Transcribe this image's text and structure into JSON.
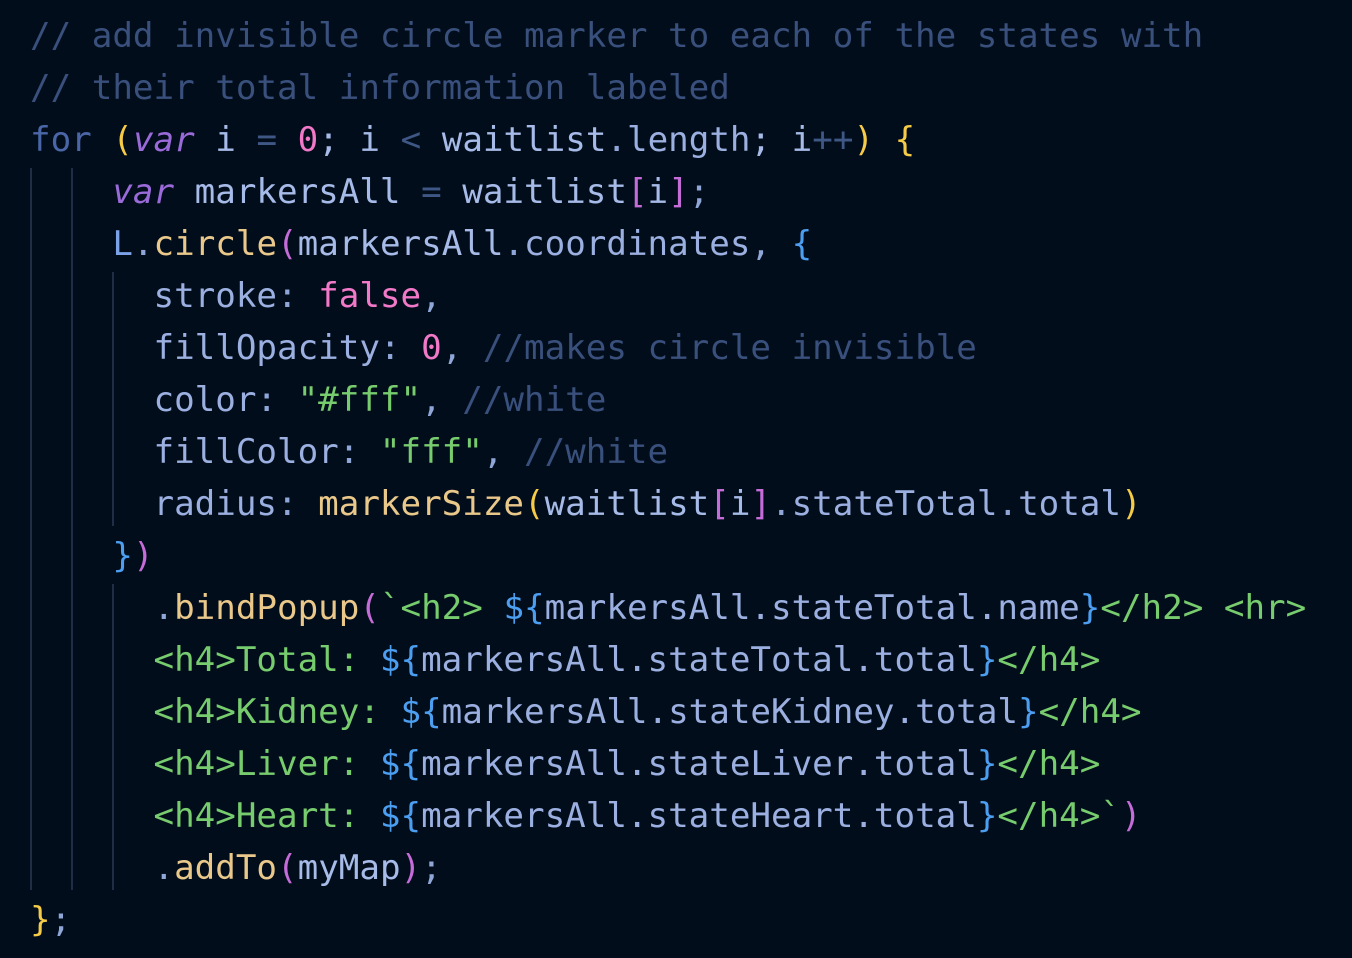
{
  "code": {
    "lines": [
      [
        {
          "t": "// add invisible circle marker to each of the states with",
          "c": "c-comment",
          "name": "comment-token"
        }
      ],
      [
        {
          "t": "// their total information labeled",
          "c": "c-comment",
          "name": "comment-token"
        }
      ],
      [
        {
          "t": "for",
          "c": "c-keyword",
          "name": "keyword-token"
        },
        {
          "t": " ",
          "c": "c-punct",
          "name": "space-token"
        },
        {
          "t": "(",
          "c": "c-paren1",
          "name": "paren-token"
        },
        {
          "t": "var",
          "c": "c-italic-kw",
          "name": "keyword-token"
        },
        {
          "t": " i ",
          "c": "c-var",
          "name": "identifier-token"
        },
        {
          "t": "=",
          "c": "c-op",
          "name": "operator-token"
        },
        {
          "t": " ",
          "c": "c-punct",
          "name": "space-token"
        },
        {
          "t": "0",
          "c": "c-num",
          "name": "number-token"
        },
        {
          "t": "; i ",
          "c": "c-var",
          "name": "identifier-token"
        },
        {
          "t": "<",
          "c": "c-op",
          "name": "operator-token"
        },
        {
          "t": " waitlist",
          "c": "c-var",
          "name": "identifier-token"
        },
        {
          "t": ".",
          "c": "c-punct",
          "name": "punct-token"
        },
        {
          "t": "length",
          "c": "c-prop",
          "name": "property-token"
        },
        {
          "t": "; i",
          "c": "c-var",
          "name": "identifier-token"
        },
        {
          "t": "++",
          "c": "c-op",
          "name": "operator-token"
        },
        {
          "t": ")",
          "c": "c-paren1",
          "name": "paren-token"
        },
        {
          "t": " ",
          "c": "c-punct",
          "name": "space-token"
        },
        {
          "t": "{",
          "c": "c-paren1",
          "name": "brace-token"
        }
      ],
      [
        {
          "t": "    ",
          "c": "c-punct",
          "name": "indent-token"
        },
        {
          "t": "var",
          "c": "c-italic-kw",
          "name": "keyword-token"
        },
        {
          "t": " markersAll ",
          "c": "c-var",
          "name": "identifier-token"
        },
        {
          "t": "=",
          "c": "c-op",
          "name": "operator-token"
        },
        {
          "t": " waitlist",
          "c": "c-var",
          "name": "identifier-token"
        },
        {
          "t": "[",
          "c": "c-paren2",
          "name": "bracket-token"
        },
        {
          "t": "i",
          "c": "c-var",
          "name": "identifier-token"
        },
        {
          "t": "]",
          "c": "c-paren2",
          "name": "bracket-token"
        },
        {
          "t": ";",
          "c": "c-punct",
          "name": "punct-token"
        }
      ],
      [
        {
          "t": "    ",
          "c": "c-punct",
          "name": "indent-token"
        },
        {
          "t": "L",
          "c": "c-obj",
          "name": "object-token"
        },
        {
          "t": ".",
          "c": "c-punct",
          "name": "punct-token"
        },
        {
          "t": "circle",
          "c": "c-func",
          "name": "function-token"
        },
        {
          "t": "(",
          "c": "c-paren2",
          "name": "paren-token"
        },
        {
          "t": "markersAll",
          "c": "c-var",
          "name": "identifier-token"
        },
        {
          "t": ".",
          "c": "c-punct",
          "name": "punct-token"
        },
        {
          "t": "coordinates",
          "c": "c-prop",
          "name": "property-token"
        },
        {
          "t": ", ",
          "c": "c-punct",
          "name": "punct-token"
        },
        {
          "t": "{",
          "c": "c-paren3",
          "name": "brace-token"
        }
      ],
      [
        {
          "t": "      ",
          "c": "c-punct",
          "name": "indent-token"
        },
        {
          "t": "stroke",
          "c": "c-prop",
          "name": "property-token"
        },
        {
          "t": ": ",
          "c": "c-punct",
          "name": "punct-token"
        },
        {
          "t": "false",
          "c": "c-num",
          "name": "boolean-token"
        },
        {
          "t": ",",
          "c": "c-punct",
          "name": "punct-token"
        }
      ],
      [
        {
          "t": "      ",
          "c": "c-punct",
          "name": "indent-token"
        },
        {
          "t": "fillOpacity",
          "c": "c-prop",
          "name": "property-token"
        },
        {
          "t": ": ",
          "c": "c-punct",
          "name": "punct-token"
        },
        {
          "t": "0",
          "c": "c-num",
          "name": "number-token"
        },
        {
          "t": ", ",
          "c": "c-punct",
          "name": "punct-token"
        },
        {
          "t": "//makes circle invisible",
          "c": "c-comment",
          "name": "comment-token"
        }
      ],
      [
        {
          "t": "      ",
          "c": "c-punct",
          "name": "indent-token"
        },
        {
          "t": "color",
          "c": "c-prop",
          "name": "property-token"
        },
        {
          "t": ": ",
          "c": "c-punct",
          "name": "punct-token"
        },
        {
          "t": "\"#fff\"",
          "c": "c-str",
          "name": "string-token"
        },
        {
          "t": ", ",
          "c": "c-punct",
          "name": "punct-token"
        },
        {
          "t": "//white",
          "c": "c-comment",
          "name": "comment-token"
        }
      ],
      [
        {
          "t": "      ",
          "c": "c-punct",
          "name": "indent-token"
        },
        {
          "t": "fillColor",
          "c": "c-prop",
          "name": "property-token"
        },
        {
          "t": ": ",
          "c": "c-punct",
          "name": "punct-token"
        },
        {
          "t": "\"fff\"",
          "c": "c-str",
          "name": "string-token"
        },
        {
          "t": ", ",
          "c": "c-punct",
          "name": "punct-token"
        },
        {
          "t": "//white",
          "c": "c-comment",
          "name": "comment-token"
        }
      ],
      [
        {
          "t": "      ",
          "c": "c-punct",
          "name": "indent-token"
        },
        {
          "t": "radius",
          "c": "c-prop",
          "name": "property-token"
        },
        {
          "t": ": ",
          "c": "c-punct",
          "name": "punct-token"
        },
        {
          "t": "markerSize",
          "c": "c-func",
          "name": "function-token"
        },
        {
          "t": "(",
          "c": "c-paren1",
          "name": "paren-token"
        },
        {
          "t": "waitlist",
          "c": "c-var",
          "name": "identifier-token"
        },
        {
          "t": "[",
          "c": "c-paren2",
          "name": "bracket-token"
        },
        {
          "t": "i",
          "c": "c-var",
          "name": "identifier-token"
        },
        {
          "t": "]",
          "c": "c-paren2",
          "name": "bracket-token"
        },
        {
          "t": ".",
          "c": "c-punct",
          "name": "punct-token"
        },
        {
          "t": "stateTotal",
          "c": "c-prop",
          "name": "property-token"
        },
        {
          "t": ".",
          "c": "c-punct",
          "name": "punct-token"
        },
        {
          "t": "total",
          "c": "c-prop",
          "name": "property-token"
        },
        {
          "t": ")",
          "c": "c-paren1",
          "name": "paren-token"
        }
      ],
      [
        {
          "t": "    ",
          "c": "c-punct",
          "name": "indent-token"
        },
        {
          "t": "}",
          "c": "c-paren3",
          "name": "brace-token"
        },
        {
          "t": ")",
          "c": "c-paren2",
          "name": "paren-token"
        }
      ],
      [
        {
          "t": "      ",
          "c": "c-punct",
          "name": "indent-token"
        },
        {
          "t": ".",
          "c": "c-punct",
          "name": "punct-token"
        },
        {
          "t": "bindPopup",
          "c": "c-func",
          "name": "function-token"
        },
        {
          "t": "(",
          "c": "c-paren2",
          "name": "paren-token"
        },
        {
          "t": "`<h2> ",
          "c": "c-str",
          "name": "string-token"
        },
        {
          "t": "${",
          "c": "c-interp",
          "name": "interpolation-token"
        },
        {
          "t": "markersAll.stateTotal.name",
          "c": "c-tmpl-var",
          "name": "template-expression-token"
        },
        {
          "t": "}",
          "c": "c-interp",
          "name": "interpolation-token"
        },
        {
          "t": "</h2> <hr>",
          "c": "c-str",
          "name": "string-token"
        }
      ],
      [
        {
          "t": "      ",
          "c": "c-punct",
          "name": "indent-token"
        },
        {
          "t": "<h4>Total: ",
          "c": "c-str",
          "name": "string-token"
        },
        {
          "t": "${",
          "c": "c-interp",
          "name": "interpolation-token"
        },
        {
          "t": "markersAll.stateTotal.total",
          "c": "c-tmpl-var",
          "name": "template-expression-token"
        },
        {
          "t": "}",
          "c": "c-interp",
          "name": "interpolation-token"
        },
        {
          "t": "</h4>",
          "c": "c-str",
          "name": "string-token"
        }
      ],
      [
        {
          "t": "      ",
          "c": "c-punct",
          "name": "indent-token"
        },
        {
          "t": "<h4>Kidney: ",
          "c": "c-str",
          "name": "string-token"
        },
        {
          "t": "${",
          "c": "c-interp",
          "name": "interpolation-token"
        },
        {
          "t": "markersAll.stateKidney.total",
          "c": "c-tmpl-var",
          "name": "template-expression-token"
        },
        {
          "t": "}",
          "c": "c-interp",
          "name": "interpolation-token"
        },
        {
          "t": "</h4>",
          "c": "c-str",
          "name": "string-token"
        }
      ],
      [
        {
          "t": "      ",
          "c": "c-punct",
          "name": "indent-token"
        },
        {
          "t": "<h4>Liver: ",
          "c": "c-str",
          "name": "string-token"
        },
        {
          "t": "${",
          "c": "c-interp",
          "name": "interpolation-token"
        },
        {
          "t": "markersAll.stateLiver.total",
          "c": "c-tmpl-var",
          "name": "template-expression-token"
        },
        {
          "t": "}",
          "c": "c-interp",
          "name": "interpolation-token"
        },
        {
          "t": "</h4>",
          "c": "c-str",
          "name": "string-token"
        }
      ],
      [
        {
          "t": "      ",
          "c": "c-punct",
          "name": "indent-token"
        },
        {
          "t": "<h4>Heart: ",
          "c": "c-str",
          "name": "string-token"
        },
        {
          "t": "${",
          "c": "c-interp",
          "name": "interpolation-token"
        },
        {
          "t": "markersAll.stateHeart.total",
          "c": "c-tmpl-var",
          "name": "template-expression-token"
        },
        {
          "t": "}",
          "c": "c-interp",
          "name": "interpolation-token"
        },
        {
          "t": "</h4>`",
          "c": "c-str",
          "name": "string-token"
        },
        {
          "t": ")",
          "c": "c-paren2",
          "name": "paren-token"
        }
      ],
      [
        {
          "t": "      ",
          "c": "c-punct",
          "name": "indent-token"
        },
        {
          "t": ".",
          "c": "c-punct",
          "name": "punct-token"
        },
        {
          "t": "addTo",
          "c": "c-func",
          "name": "function-token"
        },
        {
          "t": "(",
          "c": "c-paren2",
          "name": "paren-token"
        },
        {
          "t": "myMap",
          "c": "c-var",
          "name": "identifier-token"
        },
        {
          "t": ")",
          "c": "c-paren2",
          "name": "paren-token"
        },
        {
          "t": ";",
          "c": "c-punct",
          "name": "punct-token"
        }
      ],
      [
        {
          "t": "}",
          "c": "c-paren1",
          "name": "brace-token"
        },
        {
          "t": ";",
          "c": "c-punct",
          "name": "punct-token"
        }
      ]
    ]
  }
}
